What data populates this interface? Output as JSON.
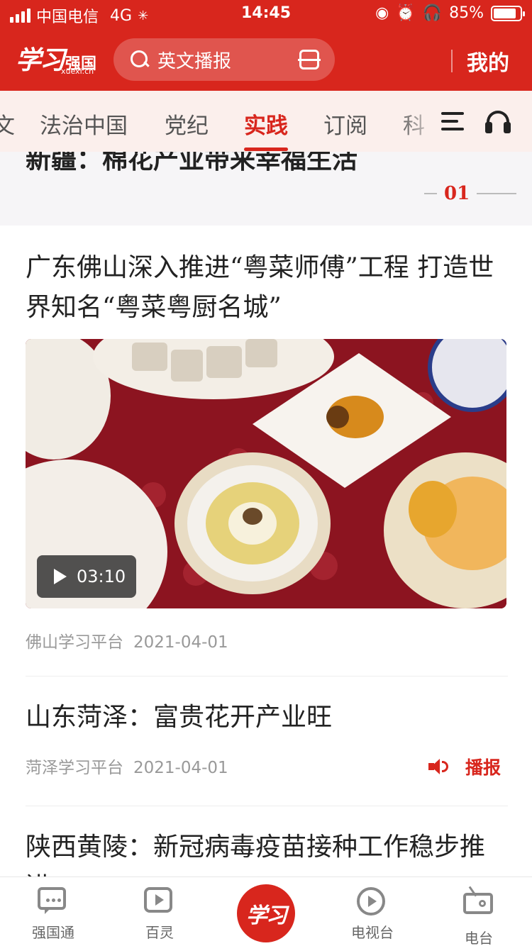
{
  "status_bar": {
    "carrier": "中国电信",
    "network": "4G",
    "time": "14:45",
    "battery": "85%",
    "battery_level": 0.85
  },
  "app_bar": {
    "logo_text": "学习",
    "logo_suffix": "强国",
    "logo_url": "xuexi.cn",
    "search_placeholder": "英文播报",
    "profile_label": "我的"
  },
  "tabs": [
    {
      "label": "法治中国",
      "active": false
    },
    {
      "label": "党纪",
      "active": false
    },
    {
      "label": "实践",
      "active": true
    },
    {
      "label": "订阅",
      "active": false
    },
    {
      "label": "科",
      "active": false
    }
  ],
  "featured": {
    "title": "新疆：棉花产业带来幸福生活",
    "page_indicator": "01"
  },
  "articles": [
    {
      "title": "广东佛山深入推进“粤菜师傅”工程 打造世界知名“粤菜粤厨名城”",
      "video_duration": "03:10",
      "source": "佛山学习平台",
      "date": "2021-04-01"
    },
    {
      "title": "山东菏泽：富贵花开产业旺",
      "source": "菏泽学习平台",
      "date": "2021-04-01",
      "action": "播报"
    },
    {
      "title": "陕西黄陵：新冠病毒疫苗接种工作稳步推进"
    }
  ],
  "bottom_nav": [
    {
      "label": "强国通",
      "icon": "chat-bubble-icon"
    },
    {
      "label": "百灵",
      "icon": "bailing-play-icon"
    },
    {
      "label": "学习",
      "icon": "xuexi-logo"
    },
    {
      "label": "电视台",
      "icon": "play-circle-icon"
    },
    {
      "label": "电台",
      "icon": "radio-icon"
    }
  ],
  "colors": {
    "brand_red": "#d8261d",
    "tab_bg": "#fbefec"
  }
}
